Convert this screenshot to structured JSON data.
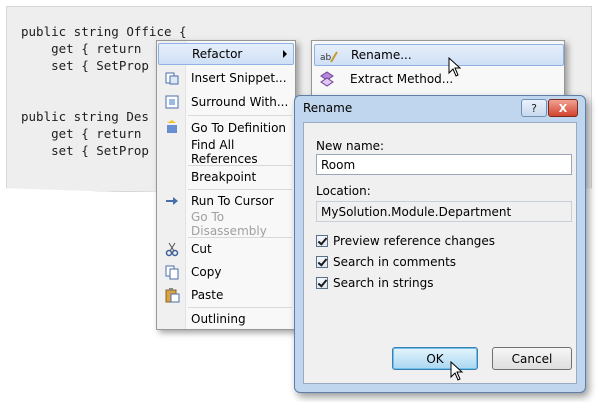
{
  "code": {
    "lines": [
      "public string Office {",
      "    get { return",
      "    set { SetProp",
      "",
      "public string Des",
      "    get { return",
      "    set { SetProp"
    ]
  },
  "context_menu": {
    "items": [
      {
        "label": "Refactor",
        "icon": "refactor-icon",
        "highlighted": true,
        "submenu": true
      },
      {
        "label": "Insert Snippet...",
        "icon": "snippet-icon"
      },
      {
        "label": "Surround With...",
        "icon": "surround-icon"
      },
      {
        "label": "Go To Definition",
        "icon": "definition-icon"
      },
      {
        "label": "Find All References",
        "icon": ""
      },
      {
        "label": "Breakpoint",
        "icon": ""
      },
      {
        "label": "Run To Cursor",
        "icon": "run-cursor-icon"
      },
      {
        "label": "Go To Disassembly",
        "icon": "",
        "disabled": true
      },
      {
        "label": "Cut",
        "icon": "scissors-icon"
      },
      {
        "label": "Copy",
        "icon": "copy-icon"
      },
      {
        "label": "Paste",
        "icon": "paste-icon"
      },
      {
        "label": "Outlining",
        "icon": ""
      }
    ]
  },
  "submenu": {
    "items": [
      {
        "label": "Rename...",
        "icon": "rename-icon",
        "highlighted": true
      },
      {
        "label": "Extract Method...",
        "icon": "extract-method-icon"
      }
    ]
  },
  "dialog": {
    "title": "Rename",
    "help_button": "?",
    "close_button": "X",
    "new_name_label": "New name:",
    "new_name_value": "Room",
    "location_label": "Location:",
    "location_value": "MySolution.Module.Department",
    "options": [
      {
        "label": "Preview reference changes",
        "checked": true
      },
      {
        "label": "Search in comments",
        "checked": true
      },
      {
        "label": "Search in strings",
        "checked": true
      }
    ],
    "ok_label": "OK",
    "cancel_label": "Cancel"
  },
  "colors": {
    "keyword": "#2a2ad2",
    "highlight": "#cfe0f6",
    "dialog_frame": "#bfd6ee"
  }
}
